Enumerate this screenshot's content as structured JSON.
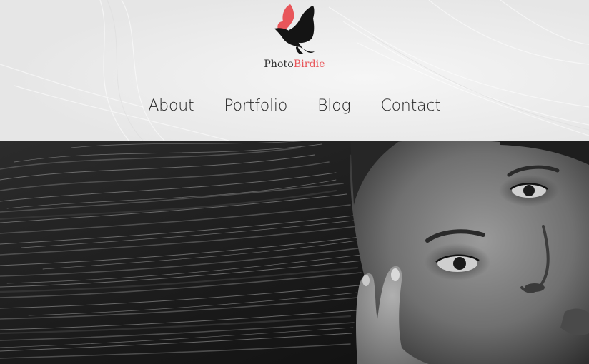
{
  "brand": {
    "name_part1": "Photo",
    "name_part2": "Birdie",
    "colors": {
      "dark": "#1a1a1a",
      "accent": "#e8565a"
    },
    "logo_icon": "bird-butterfly-logo"
  },
  "nav": {
    "items": [
      {
        "label": "About"
      },
      {
        "label": "Portfolio"
      },
      {
        "label": "Blog"
      },
      {
        "label": "Contact"
      }
    ]
  },
  "hero": {
    "image": "black-and-white-portrait-photo"
  }
}
